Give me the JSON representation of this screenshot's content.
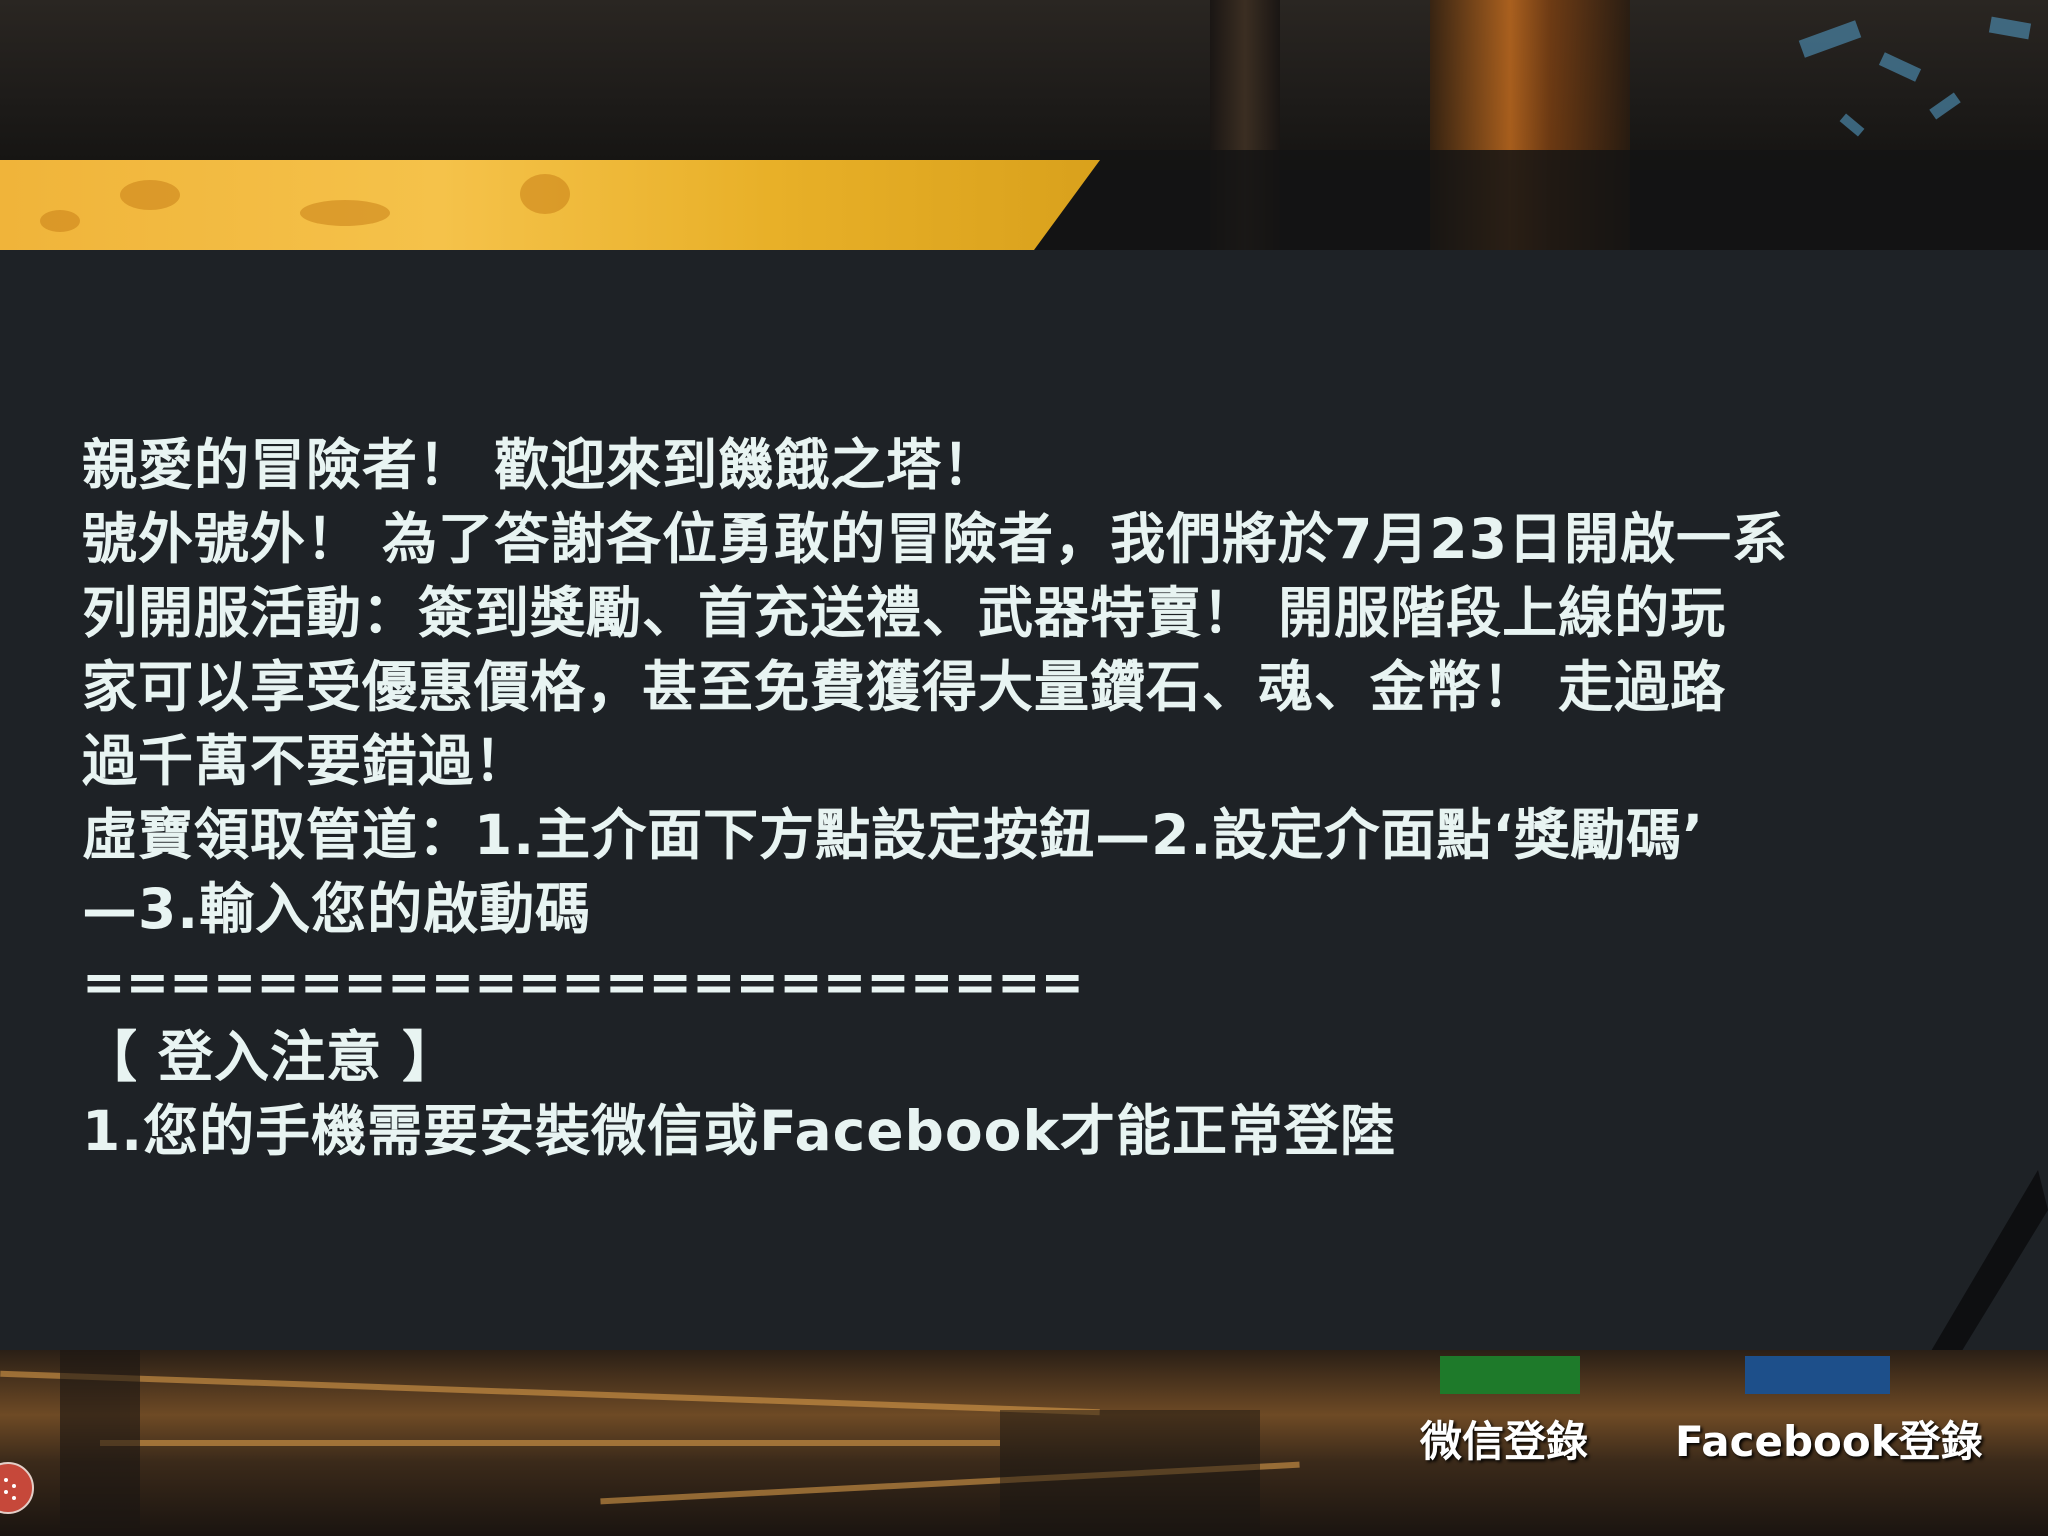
{
  "notice": {
    "lines": [
      "親愛的冒險者！ 歡迎來到饑餓之塔！",
      "號外號外！ 為了答謝各位勇敢的冒險者，我們將於7月23日開啟一系",
      "列開服活動：簽到獎勵、首充送禮、武器特賣！ 開服階段上線的玩",
      "家可以享受優惠價格，甚至免費獲得大量鑽石、魂、金幣！ 走過路",
      "過千萬不要錯過！",
      "虛寶領取管道：1.主介面下方點設定按鈕—2.設定介面點‘獎勵碼’",
      "—3.輸入您的啟動碼",
      "=======================",
      "【 登入注意 】",
      "1.您的手機需要安裝微信或Facebook才能正常登陸"
    ]
  },
  "login": {
    "wechat_label": "微信登錄",
    "facebook_label": "Facebook登錄"
  },
  "colors": {
    "panel_bg": "#1e2226",
    "text": "#e8f4f2",
    "banner_yellow": "#f5c24a"
  },
  "icons": {
    "corner": "app-menu-icon"
  }
}
